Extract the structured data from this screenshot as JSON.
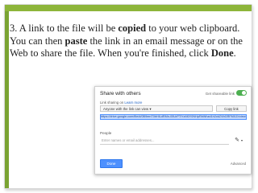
{
  "slide": {
    "instruction": {
      "prefix": "3. A link to the file will be ",
      "bold1": "copied",
      "mid1": " to your web clipboard. You can then ",
      "bold2": "paste",
      "mid2": " the link in an email message or on the Web to share the file. When you're finished, click ",
      "bold3": "Done",
      "suffix": "."
    }
  },
  "dialog": {
    "title": "Share with others",
    "get_shareable_link": "Get shareable link",
    "link_sharing_label": "Link sharing on",
    "learn_more": "Learn more",
    "access_select": "Anyone with the link can view ▾",
    "copy_link": "Copy link",
    "link_url": "https://drive.google.com/file/d/0B9emT0bHlLdRMn-05UrPTlYzM0Y0NHpRbWhzd1h2ckZVbGRFMXZr/view?usp=sharing",
    "people_label": "People",
    "people_placeholder": "Enter names or email addresses...",
    "done": "Done",
    "advanced": "Advanced"
  },
  "colors": {
    "accent": "#8db53a",
    "done_button": "#4d90fe",
    "toggle_on": "#4caf50"
  }
}
